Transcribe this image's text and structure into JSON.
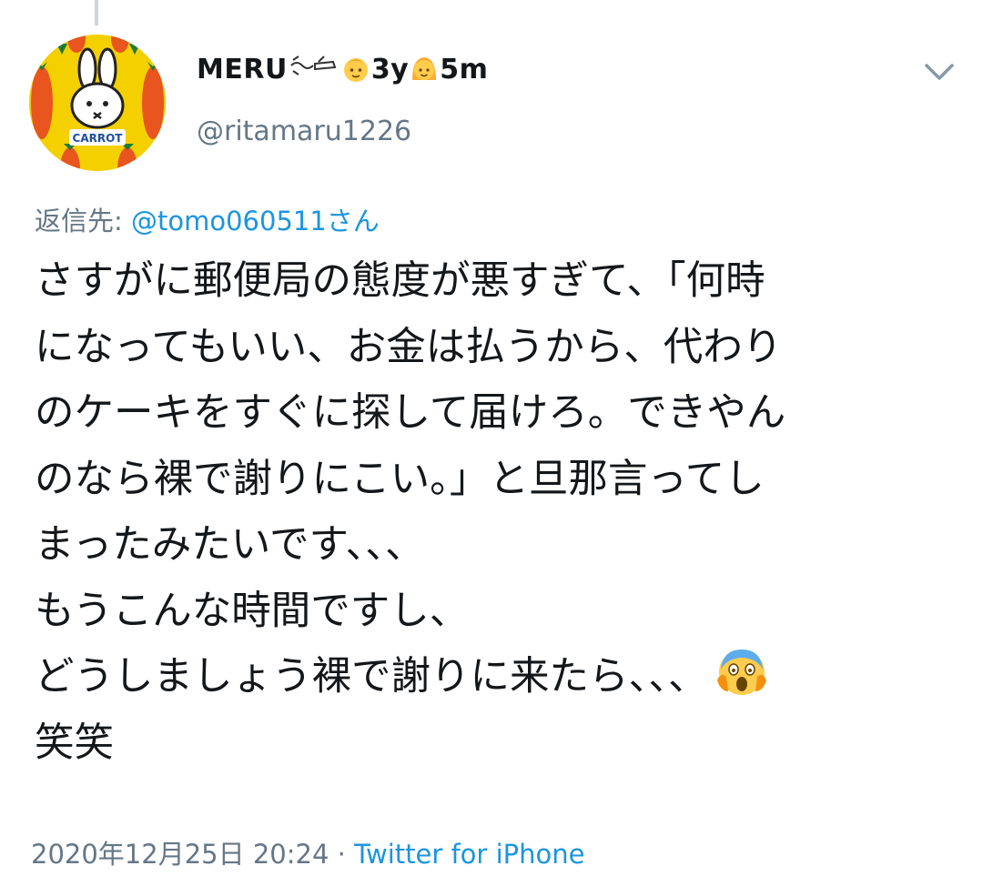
{
  "author": {
    "display_name": "MERU",
    "name_suffix": "3y",
    "name_suffix_2": "5m",
    "handle": "@ritamaru1226",
    "avatar_text": "CARROT"
  },
  "reply": {
    "prefix": "返信先: ",
    "mention": "@tomo060511さん"
  },
  "tweet": {
    "lines": [
      "さすがに郵便局の態度が悪すぎて、「何時",
      "になってもいい、お金は払うから、代わり",
      "のケーキをすぐに探して届けろ。できやん",
      "のなら裸で謝りにこい。」と旦那言ってし",
      "まったみたいです、、、",
      "もうこんな時間ですし、",
      "どうしましょう裸で謝りに来たら、、、",
      "笑笑"
    ]
  },
  "meta": {
    "timestamp": "2020年12月25日 20:24",
    "separator": " · ",
    "source": "Twitter for iPhone"
  },
  "icons": [
    "chevron-down-icon",
    "avatar",
    "hose-icon",
    "baby-boy-emoji",
    "baby-girl-emoji",
    "scream-emoji"
  ],
  "colors": {
    "text": "#14171a",
    "secondary": "#657786",
    "link": "#1b95e0",
    "avatar_bg": "#f4d000"
  }
}
